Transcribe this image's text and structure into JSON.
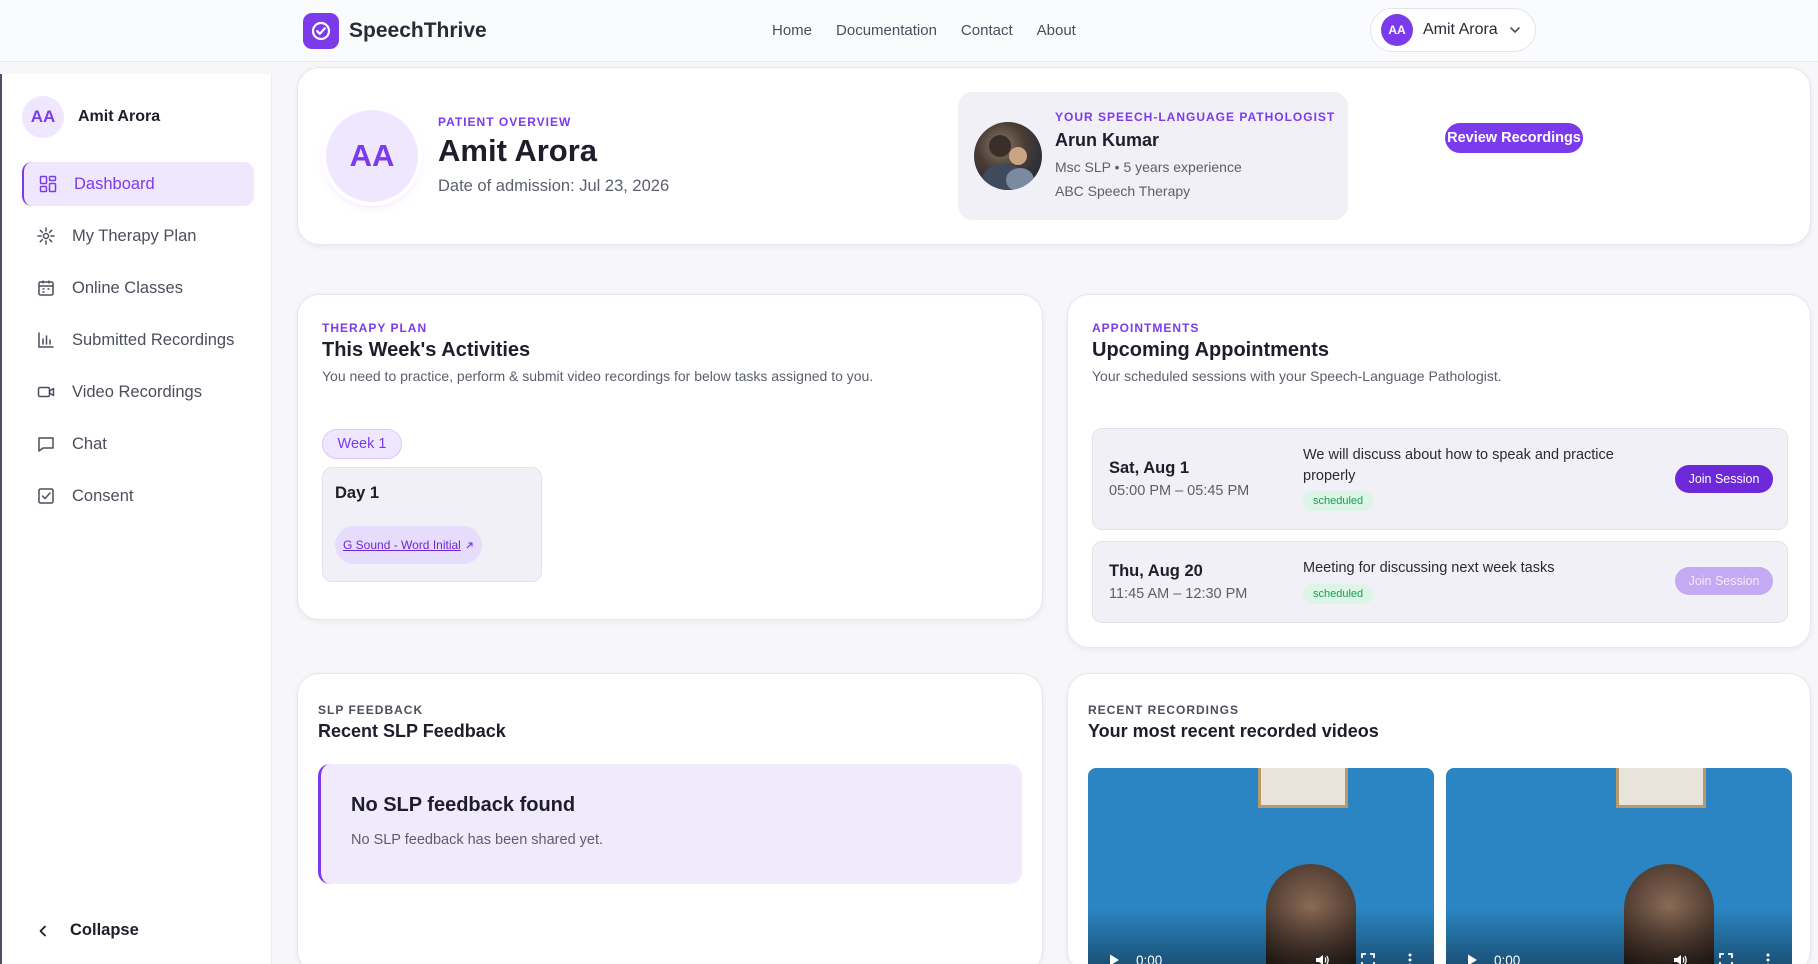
{
  "app": {
    "brand": "SpeechThrive"
  },
  "topnav": {
    "items": [
      "Home",
      "Documentation",
      "Contact",
      "About"
    ]
  },
  "user": {
    "initials": "AA",
    "name": "Amit Arora"
  },
  "sidebar": {
    "items": [
      {
        "label": "Dashboard",
        "icon": "grid-icon",
        "active": true
      },
      {
        "label": "My Therapy Plan",
        "icon": "sparkle-icon"
      },
      {
        "label": "Online Classes",
        "icon": "calendar-icon"
      },
      {
        "label": "Submitted Recordings",
        "icon": "bar-chart-icon"
      },
      {
        "label": "Video Recordings",
        "icon": "video-icon"
      },
      {
        "label": "Chat",
        "icon": "chat-icon"
      },
      {
        "label": "Consent",
        "icon": "checkbox-icon"
      }
    ],
    "collapse_label": "Collapse"
  },
  "overview": {
    "eyebrow": "PATIENT OVERVIEW",
    "initials": "AA",
    "name": "Amit Arora",
    "admission": "Date of admission: Jul 23, 2026",
    "slp": {
      "eyebrow": "YOUR SPEECH-LANGUAGE PATHOLOGIST",
      "name": "Arun Kumar",
      "credentials": "Msc SLP • 5 years experience",
      "clinic": "ABC Speech Therapy"
    },
    "review_button": "Review Recordings"
  },
  "therapy": {
    "eyebrow": "THERAPY PLAN",
    "title": "This Week's Activities",
    "subtitle": "You need to practice, perform & submit video recordings for below tasks assigned to you.",
    "week": "Week 1",
    "day": "Day 1",
    "task": "G Sound - Word Initial",
    "task_icon": "external-link-icon"
  },
  "appointments": {
    "eyebrow": "APPOINTMENTS",
    "title": "Upcoming Appointments",
    "subtitle": "Your scheduled sessions with your Speech-Language Pathologist.",
    "items": [
      {
        "date": "Sat, Aug 1",
        "time": "05:00 PM – 05:45 PM",
        "desc": "We will discuss about how to speak and practice properly",
        "status": "scheduled",
        "button": "Join Session",
        "enabled": true
      },
      {
        "date": "Thu, Aug 20",
        "time": "11:45 AM – 12:30 PM",
        "desc": "Meeting for discussing next week tasks",
        "status": "scheduled",
        "button": "Join Session",
        "enabled": false
      }
    ]
  },
  "feedback": {
    "eyebrow": "SLP FEEDBACK",
    "title": "Recent SLP Feedback",
    "empty_title": "No SLP feedback found",
    "empty_sub": "No SLP feedback has been shared yet."
  },
  "recordings": {
    "eyebrow": "RECENT RECORDINGS",
    "title": "Your most recent recorded videos",
    "videos": [
      {
        "time": "0:00"
      },
      {
        "time": "0:00"
      }
    ]
  },
  "colors": {
    "accent": "#7c3aed",
    "success": "#16a34a"
  }
}
